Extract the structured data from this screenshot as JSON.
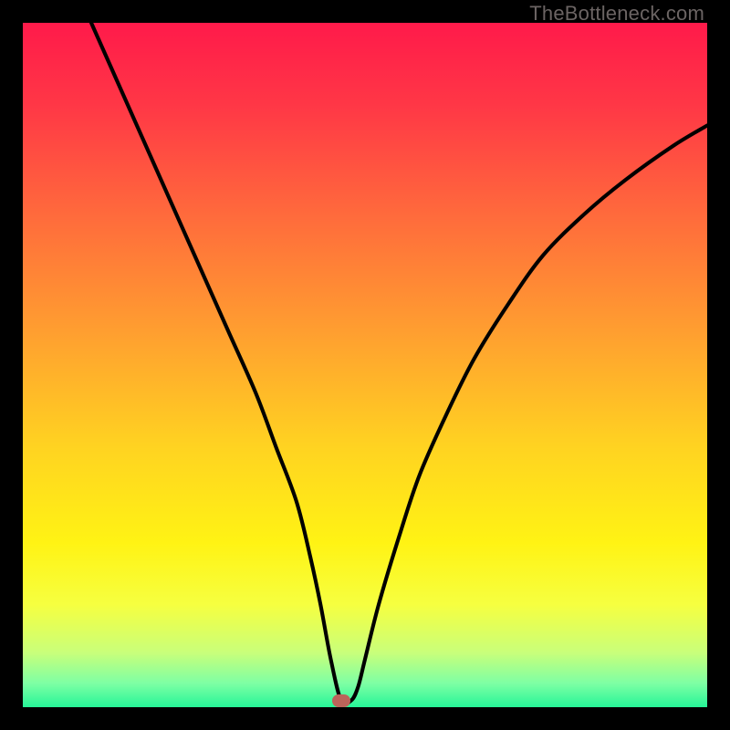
{
  "watermark": "TheBottleneck.com",
  "colors": {
    "frame": "#000000",
    "marker": "#bb645a",
    "curve": "#000000",
    "gradient_stops": [
      {
        "offset": 0.0,
        "color": "#ff1a4a"
      },
      {
        "offset": 0.12,
        "color": "#ff3746"
      },
      {
        "offset": 0.28,
        "color": "#ff6a3c"
      },
      {
        "offset": 0.45,
        "color": "#ff9e30"
      },
      {
        "offset": 0.62,
        "color": "#ffd321"
      },
      {
        "offset": 0.76,
        "color": "#fff314"
      },
      {
        "offset": 0.85,
        "color": "#f6ff40"
      },
      {
        "offset": 0.92,
        "color": "#c9ff7a"
      },
      {
        "offset": 0.965,
        "color": "#7effa4"
      },
      {
        "offset": 1.0,
        "color": "#26f598"
      }
    ]
  },
  "chart_data": {
    "type": "line",
    "title": "",
    "xlabel": "",
    "ylabel": "",
    "xlim": [
      0,
      100
    ],
    "ylim": [
      0,
      100
    ],
    "marker": {
      "x": 46.5,
      "y": 1.0
    },
    "series": [
      {
        "name": "bottleneck-curve",
        "x": [
          10,
          14,
          18,
          22,
          26,
          30,
          34,
          37,
          40,
          42,
          43.5,
          45,
          46.5,
          48,
          49,
          50,
          52,
          55,
          58,
          62,
          66,
          71,
          76,
          82,
          88,
          95,
          100
        ],
        "values": [
          100,
          91,
          82,
          73,
          64,
          55,
          46,
          38,
          30,
          22,
          15,
          7,
          1,
          1,
          3,
          7,
          15,
          25,
          34,
          43,
          51,
          59,
          66,
          72,
          77,
          82,
          85
        ]
      }
    ]
  }
}
